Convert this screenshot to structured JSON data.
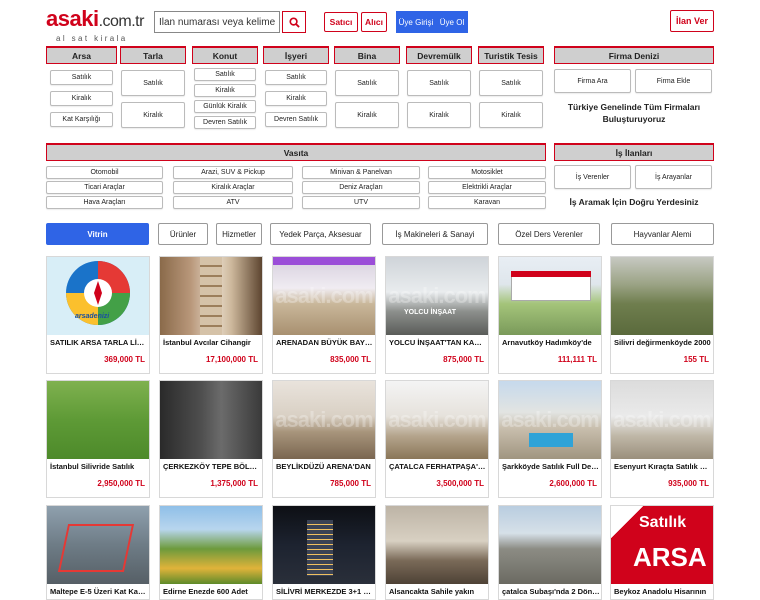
{
  "header": {
    "logo_main": "asaki",
    "logo_domain": ".com.tr",
    "logo_tagline": "al sat kirala",
    "search_placeholder": "İlan numarası veya kelime ile",
    "satici": "Satıcı",
    "alici": "Alıcı",
    "uye_girisi": "Üye Girişi",
    "uye_ol": "Üye Ol",
    "ilan_ver": "İlan Ver"
  },
  "categories": {
    "arsa": {
      "title": "Arsa",
      "items": [
        "Satılık",
        "Kiralık",
        "Kat Karşılığı"
      ]
    },
    "tarla": {
      "title": "Tarla",
      "items": [
        "Satılık",
        "Kiralık"
      ]
    },
    "konut": {
      "title": "Konut",
      "items": [
        "Satılık",
        "Kiralık",
        "Günlük Kiralık",
        "Devren Satılık"
      ]
    },
    "isyeri": {
      "title": "İşyeri",
      "items": [
        "Satılık",
        "Kiralık",
        "Devren Satılık"
      ]
    },
    "bina": {
      "title": "Bina",
      "items": [
        "Satılık",
        "Kiralık"
      ]
    },
    "devremulk": {
      "title": "Devremülk",
      "items": [
        "Satılık",
        "Kiralık"
      ]
    },
    "turistik": {
      "title": "Turistik Tesis",
      "items": [
        "Satılık",
        "Kiralık"
      ]
    },
    "firma": {
      "title": "Firma Denizi",
      "items": [
        "Firma Ara",
        "Firma Ekle"
      ],
      "text": "Türkiye Genelinde Tüm Firmaları Buluşturuyoruz"
    },
    "vasita": {
      "title": "Vasıta",
      "items": [
        "Otomobil",
        "Arazi, SUV & Pickup",
        "Minivan & Panelvan",
        "Motosiklet",
        "Ticari Araçlar",
        "Kiralık Araçlar",
        "Deniz Araçları",
        "Elektrikli Araçlar",
        "Hava Araçları",
        "ATV",
        "UTV",
        "Karavan"
      ]
    },
    "is": {
      "title": "İş İlanları",
      "items": [
        "İş Verenler",
        "İş Arayanlar"
      ],
      "text": "İş Aramak İçin Doğru Yerdesiniz"
    }
  },
  "tabs": [
    "Vitrin",
    "Ürünler",
    "Hizmetler",
    "Yedek Parça, Aksesuar",
    "İş Makineleri & Sanayi",
    "Özel Ders Verenler",
    "Hayvanlar Alemi"
  ],
  "listings": [
    {
      "title": "SATILIK ARSA TARLA LİSTESİ",
      "price": "369,000 TL"
    },
    {
      "title": "İstanbul Avcılar Cihangir",
      "price": "17,100,000 TL"
    },
    {
      "title": "ARENADAN BÜYÜK BAYRAM",
      "price": "835,000 TL"
    },
    {
      "title": "YOLCU İNŞAAT'TAN KAÇMAZ",
      "price": "875,000 TL"
    },
    {
      "title": "Arnavutköy Hadımköy'de",
      "price": "111,111 TL"
    },
    {
      "title": "Silivri değirmenköyde 2000",
      "price": "155 TL"
    },
    {
      "title": "İstanbul Silivride Satılık",
      "price": "2,950,000 TL"
    },
    {
      "title": "ÇERKEZKÖY TEPE BÖLGESİ",
      "price": "1,375,000 TL"
    },
    {
      "title": "BEYLİKDÜZÜ ARENA'DAN",
      "price": "785,000 TL"
    },
    {
      "title": "ÇATALCA FERHATPAŞA'DA",
      "price": "3,500,000 TL"
    },
    {
      "title": "Şarkköyde Satılık Full Deniz",
      "price": "2,600,000 TL"
    },
    {
      "title": "Esenyurt Kıraçta Satılık Daire",
      "price": "935,000 TL"
    },
    {
      "title": "Maltepe E-5 Üzeri Kat Karşılığı",
      "price": ""
    },
    {
      "title": "Edirne Enezde 600 Adet",
      "price": ""
    },
    {
      "title": "SİLİVRİ MERKEZDE 3+1 DAİRE",
      "price": ""
    },
    {
      "title": "Alsancakta Sahile yakın",
      "price": ""
    },
    {
      "title": "çatalca Subaşı'nda 2 Dönüm",
      "price": ""
    },
    {
      "title": "Beykoz Anadolu Hisarının",
      "price": ""
    }
  ],
  "image_text": {
    "watermark": "asaki.com",
    "arsa_denizi": "arsadenizi",
    "yolcu": "YOLCU İNŞAAT",
    "satilik": "Satılık",
    "arsa": "ARSA"
  }
}
